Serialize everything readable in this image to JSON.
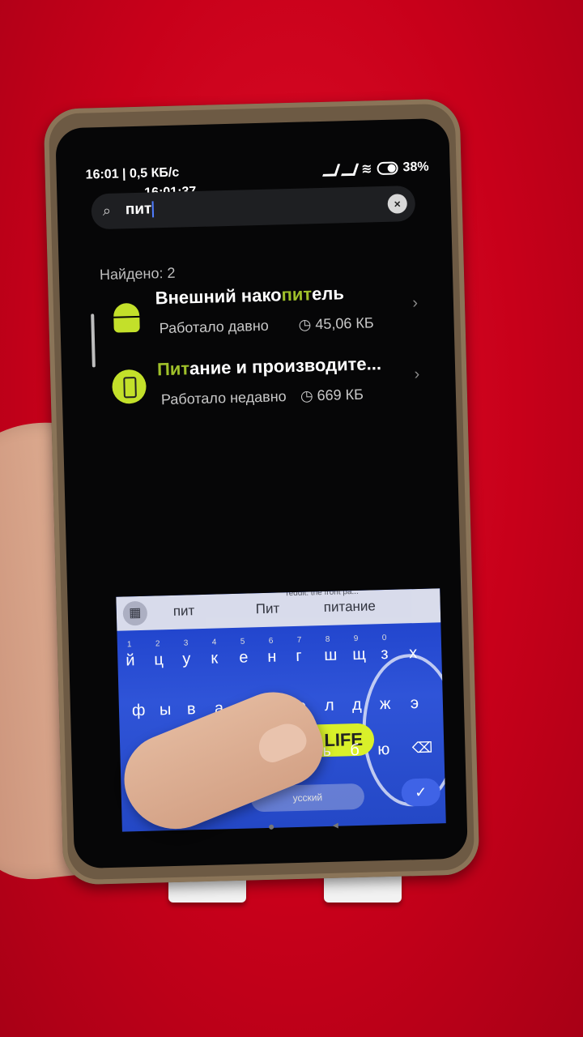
{
  "status_bar": {
    "time_info": "16:01 | 0,5 КБ/с",
    "battery": "38%"
  },
  "overlay_time": "16:01:37",
  "search": {
    "value": "пит",
    "clear_icon": "close-icon"
  },
  "results": {
    "found_label": "Найдено: 2",
    "items": [
      {
        "title_before": "Внешний нако",
        "title_match": "пит",
        "title_after": "ель",
        "status": "Работало давно",
        "size": "45,06 КБ",
        "icon": "android-icon"
      },
      {
        "title_before": "",
        "title_match": "Пит",
        "title_after": "ание и производите...",
        "status": "Работало недавно",
        "size": "669 КБ",
        "icon": "battery-icon"
      }
    ]
  },
  "keyboard": {
    "suggestions": [
      "пит",
      "Пит",
      "питание"
    ],
    "web_text": "reddit: the front pa...",
    "row1": [
      "й",
      "ц",
      "у",
      "к",
      "е",
      "н",
      "г",
      "ш",
      "щ",
      "з",
      "х"
    ],
    "row1_nums": [
      "1",
      "2",
      "3",
      "4",
      "5",
      "6",
      "7",
      "8",
      "9",
      "0"
    ],
    "row2": [
      "ф",
      "ы",
      "в",
      "а",
      "п",
      "р",
      "о",
      "л",
      "д",
      "ж",
      "э"
    ],
    "row3_visible": [
      "ь",
      "б",
      "ю"
    ],
    "banner_text": "LIFE",
    "space_label": "усский"
  }
}
